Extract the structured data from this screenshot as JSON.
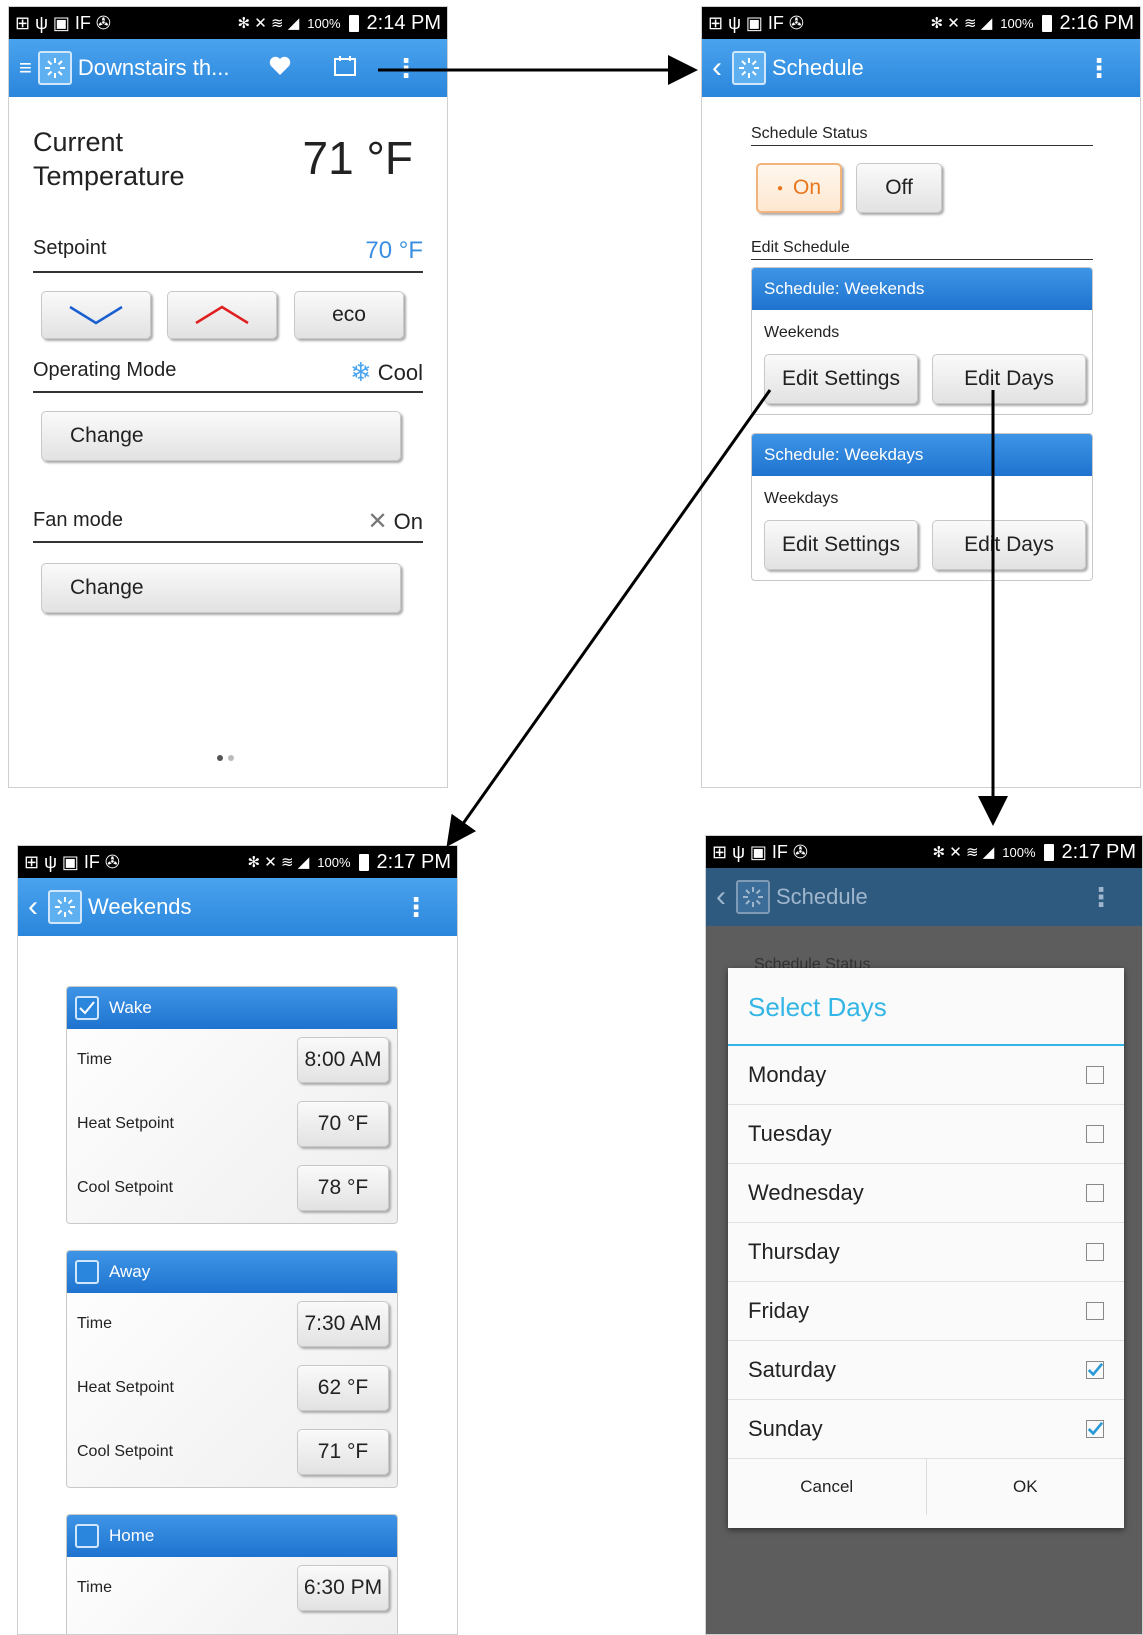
{
  "status_left_icons": "⊞ ψ ▣ IF ✇",
  "status_right_icons": "✻ ✕ ≋ ◢",
  "screen1": {
    "status": {
      "battery": "100%",
      "time": "2:14 PM"
    },
    "appbar_title": "Downstairs th...",
    "current_temperature_label": "Current\nTemperature",
    "current_temperature_value": "71 °F",
    "setpoint_label": "Setpoint",
    "setpoint_value": "70 °F",
    "eco_label": "eco",
    "operating_mode_label": "Operating Mode",
    "operating_mode_value": "Cool",
    "change_label": "Change",
    "fan_mode_label": "Fan mode",
    "fan_mode_value": "On",
    "fan_change_label": "Change"
  },
  "screen2": {
    "status": {
      "battery": "100%",
      "time": "2:16 PM"
    },
    "appbar_title": "Schedule",
    "schedule_status_label": "Schedule Status",
    "on_label": "On",
    "off_label": "Off",
    "edit_schedule_label": "Edit Schedule",
    "schedules": [
      {
        "header": "Schedule: Weekends",
        "name": "Weekends",
        "edit_settings": "Edit Settings",
        "edit_days": "Edit Days"
      },
      {
        "header": "Schedule: Weekdays",
        "name": "Weekdays",
        "edit_settings": "Edit Settings",
        "edit_days": "Edit Days"
      }
    ]
  },
  "screen3": {
    "status": {
      "battery": "100%",
      "time": "2:17 PM"
    },
    "appbar_title": "Weekends",
    "periods": [
      {
        "name": "Wake",
        "checked": true,
        "time_label": "Time",
        "time": "8:00 AM",
        "heat_label": "Heat Setpoint",
        "heat": "70 °F",
        "cool_label": "Cool Setpoint",
        "cool": "78 °F"
      },
      {
        "name": "Away",
        "checked": false,
        "time_label": "Time",
        "time": "7:30 AM",
        "heat_label": "Heat Setpoint",
        "heat": "62 °F",
        "cool_label": "Cool Setpoint",
        "cool": "71 °F"
      },
      {
        "name": "Home",
        "checked": false,
        "time_label": "Time",
        "time": "6:30 PM"
      }
    ]
  },
  "screen4": {
    "status": {
      "battery": "100%",
      "time": "2:17 PM"
    },
    "appbar_title": "Schedule",
    "behind_label": "Schedule Status",
    "dialog_title": "Select Days",
    "days": [
      {
        "name": "Monday",
        "checked": false
      },
      {
        "name": "Tuesday",
        "checked": false
      },
      {
        "name": "Wednesday",
        "checked": false
      },
      {
        "name": "Thursday",
        "checked": false
      },
      {
        "name": "Friday",
        "checked": false
      },
      {
        "name": "Saturday",
        "checked": true
      },
      {
        "name": "Sunday",
        "checked": true
      }
    ],
    "cancel_label": "Cancel",
    "ok_label": "OK"
  },
  "colors": {
    "accent": "#2a86dc",
    "dialog_title": "#33b5e5",
    "on_orange": "#e8761c",
    "dim_overlay": "#5d5d5d"
  }
}
